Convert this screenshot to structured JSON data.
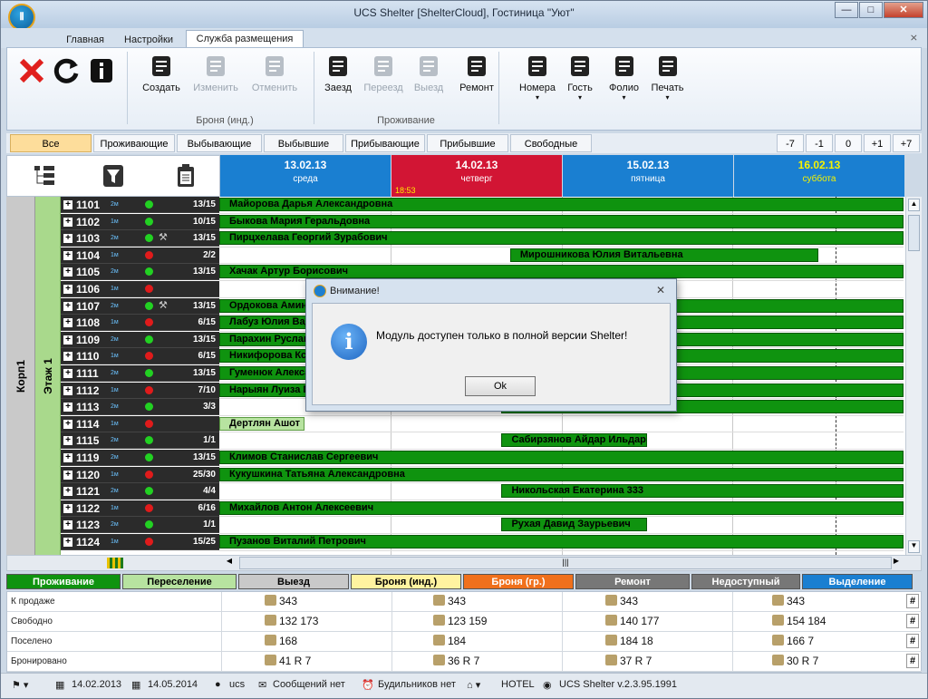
{
  "window": {
    "title": "UCS Shelter [ShelterCloud], Гостиница \"Уют\""
  },
  "tabs": [
    {
      "label": "Главная"
    },
    {
      "label": "Настройки"
    },
    {
      "label": "Служба размещения"
    }
  ],
  "ribbon": {
    "buttons": [
      {
        "label": "Создать",
        "icon": "create-booking-icon",
        "enabled": true
      },
      {
        "label": "Изменить",
        "icon": "edit-booking-icon",
        "enabled": false
      },
      {
        "label": "Отменить",
        "icon": "cancel-booking-icon",
        "enabled": false
      },
      {
        "label": "Заезд",
        "icon": "checkin-icon",
        "enabled": true
      },
      {
        "label": "Переезд",
        "icon": "move-icon",
        "enabled": false
      },
      {
        "label": "Выезд",
        "icon": "checkout-icon",
        "enabled": false
      },
      {
        "label": "Ремонт",
        "icon": "repair-icon",
        "enabled": true
      },
      {
        "label": "Номера",
        "icon": "rooms-icon",
        "enabled": true
      },
      {
        "label": "Гость",
        "icon": "guest-icon",
        "enabled": true
      },
      {
        "label": "Фолио",
        "icon": "folio-icon",
        "enabled": true
      },
      {
        "label": "Печать",
        "icon": "print-icon",
        "enabled": true
      }
    ],
    "groups": {
      "booking": "Броня (инд.)",
      "living": "Проживание"
    }
  },
  "filters": [
    "Все",
    "Проживающие",
    "Выбывающие",
    "Выбывшие",
    "Прибывающие",
    "Прибывшие",
    "Свободные"
  ],
  "shifts": [
    "-7",
    "-1",
    "0",
    "+1",
    "+7"
  ],
  "days": [
    {
      "date": "13.02.13",
      "weekday": "среда",
      "color": "#1a7fd1"
    },
    {
      "date": "14.02.13",
      "weekday": "четверг",
      "color": "#d21534",
      "time": "18:53"
    },
    {
      "date": "15.02.13",
      "weekday": "пятница",
      "color": "#1a7fd1"
    },
    {
      "date": "16.02.13",
      "weekday": "суббота",
      "color": "#1a7fd1"
    }
  ],
  "building": "Корп1",
  "floor": "Этаж 1",
  "rooms": [
    {
      "num": "1101",
      "type": "2м",
      "status": "#22d122",
      "tool": "",
      "occ": "13/15"
    },
    {
      "num": "1102",
      "type": "1м",
      "status": "#22d122",
      "tool": "",
      "occ": "10/15"
    },
    {
      "num": "1103",
      "type": "2м",
      "status": "#22d122",
      "tool": "⚒",
      "occ": "13/15"
    },
    {
      "num": "1104",
      "type": "1м",
      "status": "#e01b1b",
      "tool": "",
      "occ": "2/2"
    },
    {
      "num": "1105",
      "type": "2м",
      "status": "#22d122",
      "tool": "",
      "occ": "13/15"
    },
    {
      "num": "1106",
      "type": "1м",
      "status": "#e01b1b",
      "tool": "",
      "occ": ""
    },
    {
      "num": "1107",
      "type": "2м",
      "status": "#22d122",
      "tool": "⚒",
      "occ": "13/15"
    },
    {
      "num": "1108",
      "type": "1м",
      "status": "#e01b1b",
      "tool": "",
      "occ": "6/15"
    },
    {
      "num": "1109",
      "type": "2м",
      "status": "#22d122",
      "tool": "",
      "occ": "13/15"
    },
    {
      "num": "1110",
      "type": "1м",
      "status": "#e01b1b",
      "tool": "",
      "occ": "6/15"
    },
    {
      "num": "1111",
      "type": "2м",
      "status": "#22d122",
      "tool": "",
      "occ": "13/15"
    },
    {
      "num": "1112",
      "type": "1м",
      "status": "#e01b1b",
      "tool": "",
      "occ": "7/10"
    },
    {
      "num": "1113",
      "type": "2м",
      "status": "#22d122",
      "tool": "",
      "occ": "3/3"
    },
    {
      "num": "1114",
      "type": "1м",
      "status": "#e01b1b",
      "tool": "",
      "occ": ""
    },
    {
      "num": "1115",
      "type": "2м",
      "status": "#22d122",
      "tool": "",
      "occ": "1/1"
    },
    {
      "num": "1119",
      "type": "2м",
      "status": "#22d122",
      "tool": "",
      "occ": "13/15"
    },
    {
      "num": "1120",
      "type": "1м",
      "status": "#e01b1b",
      "tool": "",
      "occ": "25/30"
    },
    {
      "num": "1121",
      "type": "2м",
      "status": "#22d122",
      "tool": "",
      "occ": "4/4"
    },
    {
      "num": "1122",
      "type": "1м",
      "status": "#e01b1b",
      "tool": "",
      "occ": "6/16"
    },
    {
      "num": "1123",
      "type": "2м",
      "status": "#22d122",
      "tool": "",
      "occ": "1/1"
    },
    {
      "num": "1124",
      "type": "1м",
      "status": "#e01b1b",
      "tool": "",
      "occ": "15/25"
    }
  ],
  "bookings": [
    {
      "row": 0,
      "name": "Майорова Дарья Александровна",
      "start": 0,
      "end": 4,
      "light": false
    },
    {
      "row": 1,
      "name": "Быкова Мария Геральдовна",
      "start": 0,
      "end": 4,
      "light": false
    },
    {
      "row": 2,
      "name": "Пирцхелава Георгий Зурабович",
      "start": 0,
      "end": 4,
      "light": false
    },
    {
      "row": 3,
      "name": "Мирошникова Юлия Витальевна",
      "start": 1.7,
      "end": 3.5,
      "light": false
    },
    {
      "row": 4,
      "name": "Хачак Артур Борисович",
      "start": 0,
      "end": 4,
      "light": false
    },
    {
      "row": 6,
      "name": "Ордокова Амина",
      "start": 0,
      "end": 4,
      "light": false
    },
    {
      "row": 7,
      "name": "Лабуз Юлия Вад",
      "start": 0,
      "end": 4,
      "light": false
    },
    {
      "row": 8,
      "name": "Парахин Руслан",
      "start": 0,
      "end": 4,
      "light": false
    },
    {
      "row": 9,
      "name": "Никифорова Кс",
      "start": 0,
      "end": 4,
      "light": false
    },
    {
      "row": 10,
      "name": "Гуменюк Алекса",
      "start": 0,
      "end": 4,
      "light": false
    },
    {
      "row": 11,
      "name": "Нарыян Луиза Ге",
      "start": 0,
      "end": 4,
      "light": false
    },
    {
      "row": 12,
      "name": "",
      "start": 1.65,
      "end": 4,
      "light": false
    },
    {
      "row": 13,
      "name": "Дертлян Ашот",
      "start": 0,
      "end": 0.5,
      "light": true
    },
    {
      "row": 14,
      "name": "Сабирзянов Айдар Ильдарович",
      "start": 1.65,
      "end": 2.5,
      "light": false
    },
    {
      "row": 15,
      "name": "Климов Станислав Сергеевич",
      "start": 0,
      "end": 4,
      "light": false
    },
    {
      "row": 16,
      "name": "Кукушкина Татьяна Александровна",
      "start": 0,
      "end": 4,
      "light": false
    },
    {
      "row": 17,
      "name": "Никольская Екатерина 333",
      "start": 1.65,
      "end": 4,
      "light": false
    },
    {
      "row": 18,
      "name": "Михайлов Антон Алексеевич",
      "start": 0,
      "end": 4,
      "light": false
    },
    {
      "row": 19,
      "name": "Рухая Давид Заурьевич",
      "start": 1.65,
      "end": 2.5,
      "light": false
    },
    {
      "row": 20,
      "name": "Пузанов Виталий Петрович",
      "start": 0,
      "end": 4,
      "light": false
    }
  ],
  "legend": [
    {
      "label": "Проживание",
      "bg": "#0f930f",
      "fg": "#ffffff",
      "w": 126
    },
    {
      "label": "Переселение",
      "bg": "#b7e3a0",
      "fg": "#000000",
      "w": 126
    },
    {
      "label": "Выезд",
      "bg": "#c9c9c9",
      "fg": "#000000",
      "w": 122
    },
    {
      "label": "Броня (инд.)",
      "bg": "#fff3a0",
      "fg": "#000000",
      "w": 122
    },
    {
      "label": "Броня (гр.)",
      "bg": "#f0701c",
      "fg": "#ffffff",
      "w": 122
    },
    {
      "label": "Ремонт",
      "bg": "#777777",
      "fg": "#ffffff",
      "w": 126
    },
    {
      "label": "Недоступный",
      "bg": "#777777",
      "fg": "#ffffff",
      "w": 120
    },
    {
      "label": "Выделение",
      "bg": "#1a7fd1",
      "fg": "#ffffff",
      "w": 122
    }
  ],
  "stats": [
    {
      "label": "К продаже",
      "cells": [
        "343",
        "343",
        "343",
        "343"
      ]
    },
    {
      "label": "Свободно",
      "cells": [
        "132   173",
        "123   159",
        "140   177",
        "154   184"
      ]
    },
    {
      "label": "Поселено",
      "cells": [
        "168",
        "184",
        "184   18",
        "166   7"
      ]
    },
    {
      "label": "Бронировано",
      "cells": [
        "41   R 7",
        "36   R 7",
        "37   R 7",
        "30   R 7"
      ]
    }
  ],
  "hash": "#",
  "statusbar": {
    "date_from": "14.02.2013",
    "date_to": "14.05.2014",
    "user": "ucs",
    "messages": "Сообщений нет",
    "alarms": "Будильников нет",
    "hotel": "HOTEL",
    "version": "UCS Shelter v.2.3.95.1991"
  },
  "dialog": {
    "title": "Внимание!",
    "message": "Модуль доступен только в полной версии Shelter!",
    "ok": "Ok"
  }
}
